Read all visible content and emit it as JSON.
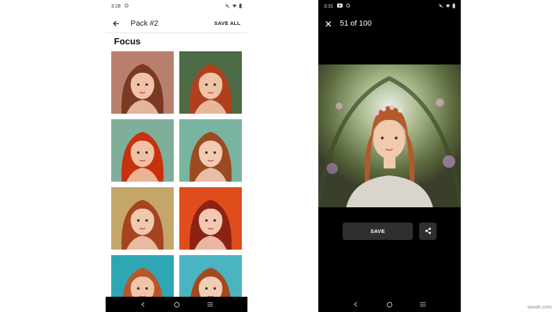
{
  "left_phone": {
    "status_time": "3:28",
    "app_title": "Pack #2",
    "save_all_label": "SAVE ALL",
    "section_title": "Focus",
    "thumbnails": [
      {
        "name": "portrait-1",
        "bg": "#b8806c",
        "hair": "#7a3a22",
        "skin": "#f1c2aa"
      },
      {
        "name": "portrait-2",
        "bg": "#4d6b44",
        "hair": "#b0401c",
        "skin": "#efc3a8"
      },
      {
        "name": "portrait-3",
        "bg": "#7fae9b",
        "hair": "#c7310f",
        "skin": "#f0c1a4"
      },
      {
        "name": "portrait-4",
        "bg": "#79b4a0",
        "hair": "#9a4b22",
        "skin": "#f1cbb2"
      },
      {
        "name": "portrait-5",
        "bg": "#c4a66a",
        "hair": "#a5441f",
        "skin": "#f0c8ae"
      },
      {
        "name": "portrait-6",
        "bg": "#e04d1c",
        "hair": "#8c2214",
        "skin": "#f4c7b2"
      },
      {
        "name": "portrait-7",
        "bg": "#2fa6b4",
        "hair": "#b8562a",
        "skin": "#f0c4a6"
      },
      {
        "name": "portrait-8",
        "bg": "#4ab4c0",
        "hair": "#a5481f",
        "skin": "#f2cdb6"
      }
    ]
  },
  "right_phone": {
    "status_time": "3:31",
    "counter": "51 of 100",
    "save_label": "SAVE",
    "image": {
      "bg": "#5e6e46",
      "hair": "#b45a28",
      "skin": "#f1c9ad",
      "dress": "#d9d4cc"
    }
  },
  "watermark": "wsxdn.com",
  "icons": {
    "back": "back-arrow-icon",
    "close": "close-icon",
    "share": "share-icon",
    "nav_back": "nav-back-icon",
    "nav_home": "nav-home-icon",
    "nav_recents": "nav-recents-icon"
  }
}
